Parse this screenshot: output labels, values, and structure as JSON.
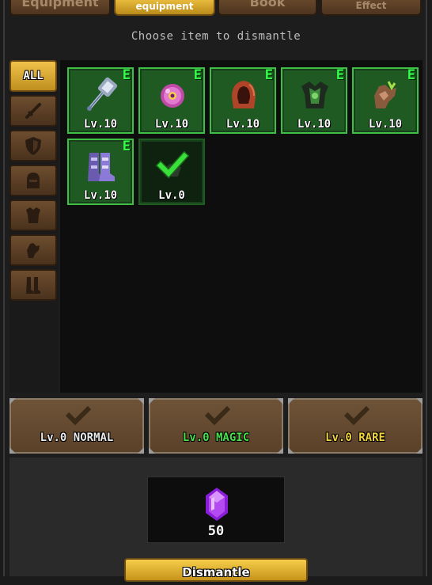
{
  "tabs": [
    {
      "label": "Equipment",
      "active": false
    },
    {
      "label": "equipment",
      "active": true
    },
    {
      "label": "Book",
      "active": false
    },
    {
      "label": "Effect",
      "active": false
    }
  ],
  "subtitle": "Choose item to dismantle",
  "filters": [
    {
      "label": "ALL",
      "icon": "all",
      "active": true
    },
    {
      "label": "",
      "icon": "sword-icon"
    },
    {
      "label": "",
      "icon": "shield-icon"
    },
    {
      "label": "",
      "icon": "helmet-icon"
    },
    {
      "label": "",
      "icon": "armor-icon"
    },
    {
      "label": "",
      "icon": "gauntlet-icon"
    },
    {
      "label": "",
      "icon": "boots-icon"
    }
  ],
  "items": [
    {
      "name": "hammer",
      "icon": "warhammer-icon",
      "level": "Lv.10",
      "badge": "E",
      "selected": true
    },
    {
      "name": "orb",
      "icon": "pink-orb-icon",
      "level": "Lv.10",
      "badge": "E",
      "selected": true
    },
    {
      "name": "hood",
      "icon": "red-hood-icon",
      "level": "Lv.10",
      "badge": "E",
      "selected": true
    },
    {
      "name": "green-armor",
      "icon": "green-armor-icon",
      "level": "Lv.10",
      "badge": "E",
      "selected": true
    },
    {
      "name": "gauntlet",
      "icon": "gauntlet-icon",
      "level": "Lv.10",
      "badge": "E",
      "selected": true
    },
    {
      "name": "boots",
      "icon": "purple-boots-icon",
      "level": "Lv.10",
      "badge": "E",
      "selected": true
    },
    {
      "name": "checked-item",
      "icon": "green-check-icon",
      "level": "Lv.0",
      "badge": "",
      "selected": false
    }
  ],
  "rarity_buttons": [
    {
      "label": "Lv.0 NORMAL",
      "color": "#e8e8e8"
    },
    {
      "label": "Lv.0 MAGIC",
      "color": "#46e04a"
    },
    {
      "label": "Lv.0 RARE",
      "color": "#f2d23a"
    }
  ],
  "reward": {
    "icon": "purple-gem-icon",
    "amount": "50"
  },
  "dismantle_button": "Dismantle"
}
